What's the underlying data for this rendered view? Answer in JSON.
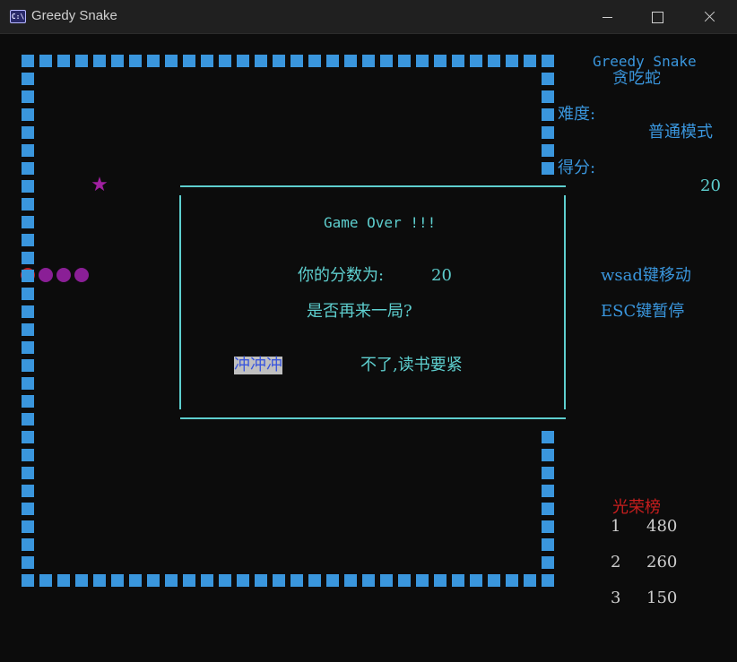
{
  "window": {
    "title": "Greedy Snake",
    "icon_text": "C:\\"
  },
  "panel": {
    "title_en": "Greedy Snake",
    "title_cn": "贪吃蛇",
    "difficulty_label": "难度:",
    "difficulty_value": "普通模式",
    "score_label": "得分:",
    "score_value": "20",
    "help_move": "wsad键移动",
    "help_pause": "ESC键暂停"
  },
  "leaderboard": {
    "title": "光荣榜",
    "entries": [
      {
        "rank": "1",
        "score": "480"
      },
      {
        "rank": "2",
        "score": "260"
      },
      {
        "rank": "3",
        "score": "150"
      }
    ]
  },
  "dialog": {
    "title": "Game Over !!!",
    "score_label": "你的分数为:",
    "score_value": "20",
    "question": "是否再来一局?",
    "option_yes": "冲冲冲",
    "option_no": "不了,读书要紧"
  },
  "game": {
    "food_symbol": "★",
    "colors": {
      "wall": "#3a96dd",
      "food": "#a020a0",
      "snake_head": "#c81e1e",
      "snake_body": "#8a1f96",
      "dialog_border": "#5ecfcf",
      "text": "#5ecfcf"
    }
  }
}
